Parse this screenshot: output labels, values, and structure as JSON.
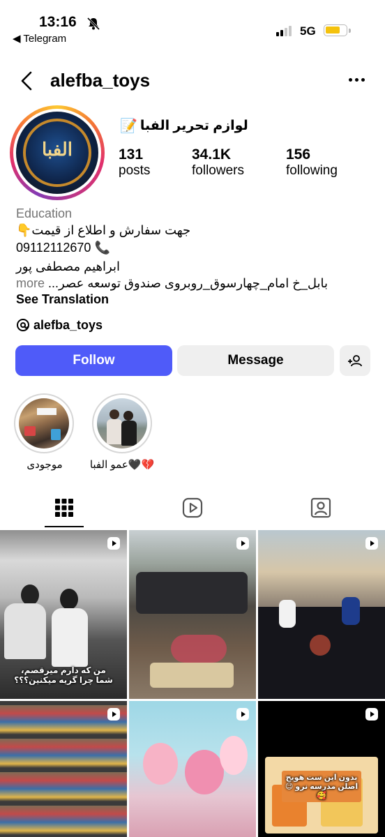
{
  "status_bar": {
    "time": "13:16",
    "back_app": "◀ Telegram",
    "network": "5G",
    "icons": [
      "bell-muted-icon",
      "signal-icon",
      "battery-icon"
    ]
  },
  "header": {
    "username": "alefba_toys",
    "icons": [
      "back-arrow-icon",
      "more-options-icon"
    ]
  },
  "profile": {
    "avatar_text": "الفبا",
    "name": "لوازم تحریر الفبا",
    "name_emoji": "📝",
    "stats": [
      {
        "value": "131",
        "label": "posts"
      },
      {
        "value": "34.1K",
        "label": "followers"
      },
      {
        "value": "156",
        "label": "following"
      }
    ]
  },
  "bio": {
    "category": "Education",
    "line1": "جهت سفارش و اطلاع از قیمت👇",
    "line2": "09112112670 📞",
    "line3": "ابراهیم مصطفی پور",
    "line4": "بابل_خ امام_چهارسوق_روبروی صندوق توسعه عصر...",
    "more": "more",
    "see_translation": "See Translation",
    "threads_handle": "alefba_toys"
  },
  "actions": {
    "follow": "Follow",
    "message": "Message",
    "colors": {
      "follow_bg": "#4f5bf9",
      "secondary_bg": "#efefef"
    }
  },
  "highlights": [
    {
      "label": "موجودی"
    },
    {
      "label": "عمو الفبا🖤💔"
    }
  ],
  "tabs": [
    "grid-icon",
    "reels-icon",
    "tagged-icon"
  ],
  "posts": [
    {
      "caption": "من که دارم میرقصم،\nشما چرا گریه میکنین؟؟؟",
      "reel": true
    },
    {
      "caption": "",
      "reel": true
    },
    {
      "caption": "",
      "reel": true
    },
    {
      "caption": "",
      "reel": true
    },
    {
      "caption": "",
      "reel": true
    },
    {
      "caption": "بدون این ست هویج\nاصلن مدرسه نرو 😉🥰",
      "reel": true
    }
  ]
}
